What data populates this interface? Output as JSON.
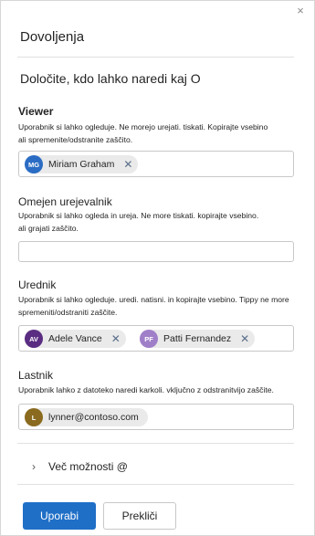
{
  "dialog": {
    "title": "Dovoljenja",
    "close_icon": "×",
    "intro": "Določite, kdo lahko naredi kaj O"
  },
  "sections": [
    {
      "title": "Viewer",
      "description_line1": "Uporabnik si lahko ogleduje. Ne morejo urejati. tiskati. Kopirajte vsebino",
      "description_line2": "ali spremenite/odstranite zaščito.",
      "chips": [
        {
          "initials": "MG",
          "name": "Miriam Graham",
          "color": "#2b6cc4"
        }
      ]
    },
    {
      "title": "Omejen urejevalnik",
      "description_line1": "Uporabnik si lahko ogleda in ureja. Ne more tiskati. kopirajte vsebino.",
      "description_line2": "ali grajati zaščito.",
      "chips": []
    },
    {
      "title": "Urednik",
      "description_line1": "Uporabnik si lahko ogleduje. uredi. natisni. in kopirajte vsebino. Tippy ne more",
      "description_line2": "spremeniti/odstraniti zaščite.",
      "chips": [
        {
          "initials": "AV",
          "name": "Adele Vance",
          "color": "#5a2d82"
        },
        {
          "initials": "PF",
          "name": "Patti Fernandez",
          "color": "#a07fc9"
        }
      ]
    },
    {
      "title": "Lastnik",
      "description_line1": "Uporabnik lahko z datoteko naredi karkoli. vključno z odstranitvijo zaščite.",
      "description_line2": "",
      "chips": [
        {
          "initials": "L",
          "name": "lynner@contoso.com",
          "color": "#8a6a1e"
        }
      ]
    }
  ],
  "more_options": {
    "label": "Več možnosti @",
    "chevron": "›"
  },
  "footer": {
    "primary_label": "Uporabi",
    "secondary_label": "Prekliči"
  },
  "chip_remove_icon": "✕"
}
